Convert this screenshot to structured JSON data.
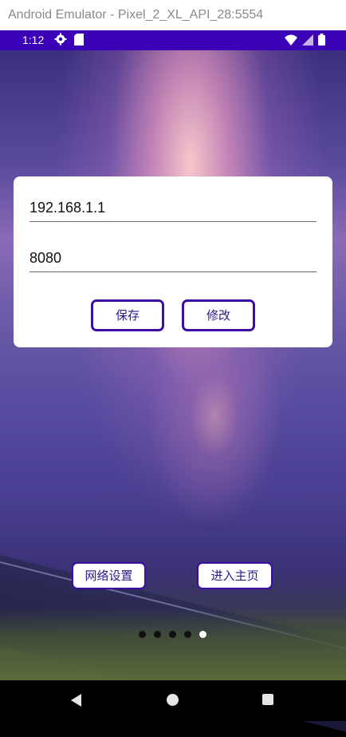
{
  "window": {
    "title": "Android Emulator - Pixel_2_XL_API_28:5554"
  },
  "status_bar": {
    "time": "1:12",
    "color": "#3a01b6"
  },
  "settings_card": {
    "ip_value": "192.168.1.1",
    "port_value": "8080",
    "save_label": "保存",
    "edit_label": "修改"
  },
  "bottom": {
    "network_settings_label": "网络设置",
    "enter_home_label": "进入主页"
  },
  "pager": {
    "count": 5,
    "active_index": 4
  },
  "accent_color": "#3c0ca6"
}
